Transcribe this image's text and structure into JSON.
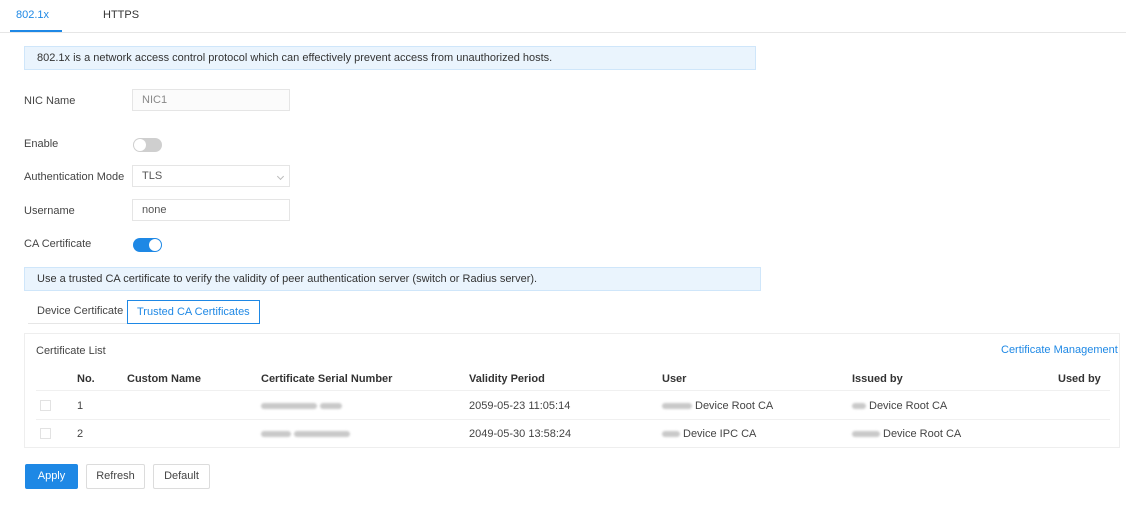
{
  "tabs": [
    {
      "label": "802.1x",
      "active": true
    },
    {
      "label": "HTTPS",
      "active": false
    }
  ],
  "intro_note": "802.1x is a network access control protocol which can effectively prevent access from unauthorized hosts.",
  "form": {
    "nic_name": {
      "label": "NIC Name",
      "value": "NIC1"
    },
    "enable": {
      "label": "Enable",
      "on": false
    },
    "auth_mode": {
      "label": "Authentication Mode",
      "value": "TLS"
    },
    "username": {
      "label": "Username",
      "value": "none"
    },
    "ca_certificate": {
      "label": "CA Certificate",
      "on": true
    }
  },
  "ca_note": "Use a trusted CA certificate to verify the validity of peer authentication server (switch or Radius server).",
  "subtabs": [
    {
      "label": "Device Certificate",
      "selected": false
    },
    {
      "label": "Trusted CA Certificates",
      "selected": true
    }
  ],
  "certificate_list": {
    "title": "Certificate List",
    "management_link": "Certificate Management",
    "columns": [
      "No.",
      "Custom Name",
      "Certificate Serial Number",
      "Validity Period",
      "User",
      "Issued by",
      "Used by"
    ],
    "rows": [
      {
        "no": "1",
        "custom_name": "",
        "serial": "",
        "validity": "2059-05-23 11:05:14",
        "user": "Device Root CA",
        "issued_by": "Device Root CA",
        "used_by": ""
      },
      {
        "no": "2",
        "custom_name": "",
        "serial": "",
        "validity": "2049-05-30 13:58:24",
        "user": "Device IPC CA",
        "issued_by": "Device Root CA",
        "used_by": ""
      }
    ]
  },
  "buttons": {
    "apply": "Apply",
    "refresh": "Refresh",
    "default": "Default"
  },
  "colors": {
    "accent": "#1e88e5",
    "info_bg": "#eaf4fd"
  }
}
